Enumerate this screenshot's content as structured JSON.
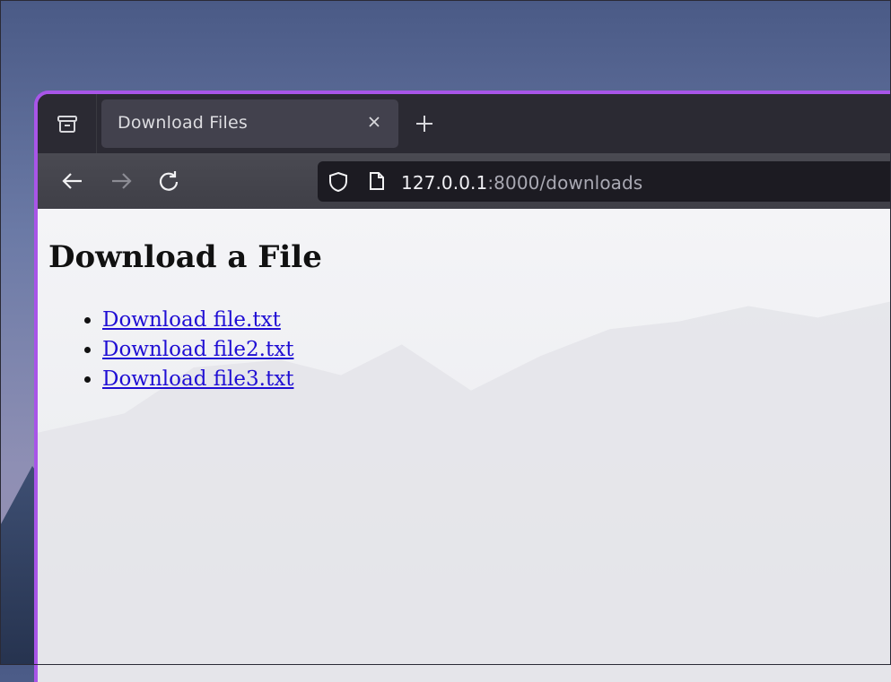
{
  "browser": {
    "tab": {
      "title": "Download Files"
    },
    "address_bar": {
      "host": "127.0.0.1",
      "rest": ":8000/downloads"
    }
  },
  "page": {
    "heading": "Download a File",
    "links": [
      {
        "label": "Download file.txt"
      },
      {
        "label": "Download file2.txt"
      },
      {
        "label": "Download file3.txt"
      }
    ]
  },
  "colors": {
    "window_border": "#a855e8",
    "tabbar": "#2b2a33",
    "active_tab": "#42414d",
    "link": "#1f0ed4"
  },
  "icons": [
    "tab-overview-icon",
    "close-icon",
    "plus-icon",
    "back-arrow-icon",
    "forward-arrow-icon",
    "reload-icon",
    "shield-icon",
    "page-icon"
  ]
}
